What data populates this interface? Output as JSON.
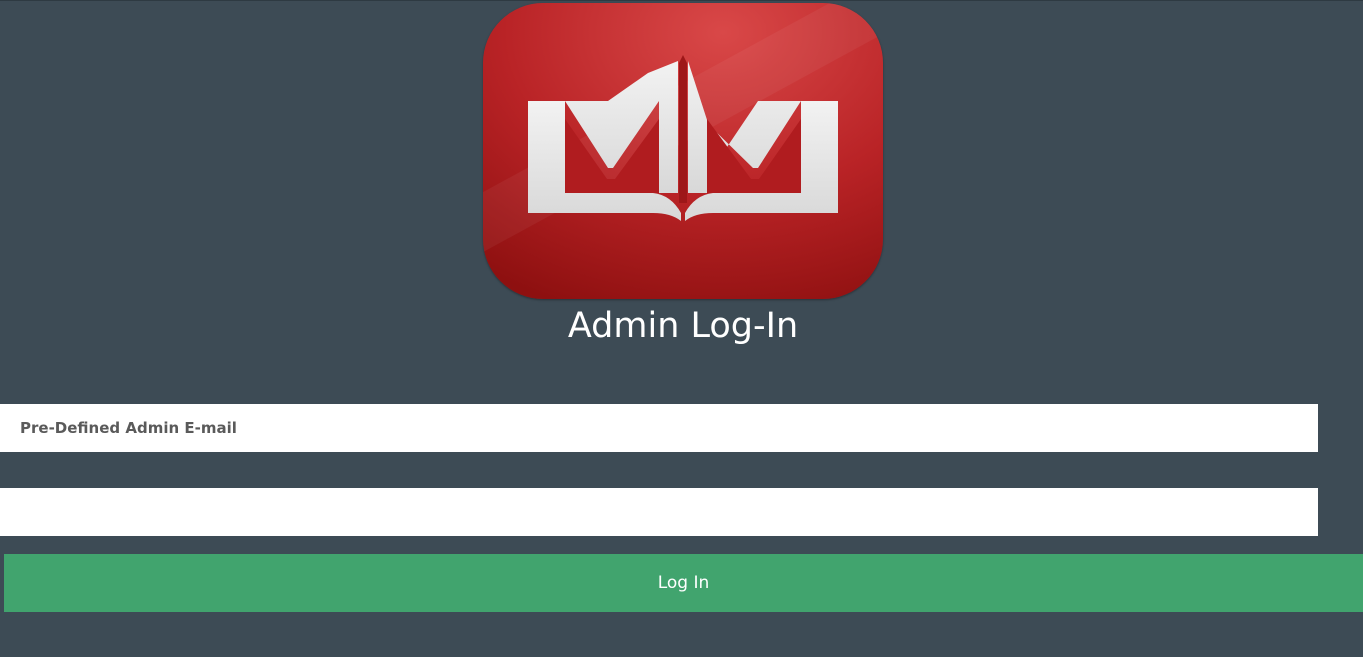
{
  "logo": {
    "icon": "mm-crown-logo",
    "colors": {
      "red_light": "#d44444",
      "red_dark": "#8e1010",
      "mark": "#e6e6e6"
    }
  },
  "header": {
    "title": "Admin Log-In"
  },
  "form": {
    "email": {
      "placeholder": "Pre-Defined Admin E-mail",
      "value": ""
    },
    "password": {
      "placeholder": "",
      "value": ""
    },
    "submit_label": "Log In"
  },
  "colors": {
    "background": "#3d4b55",
    "button": "#41a46e",
    "input_bg": "#ffffff"
  }
}
